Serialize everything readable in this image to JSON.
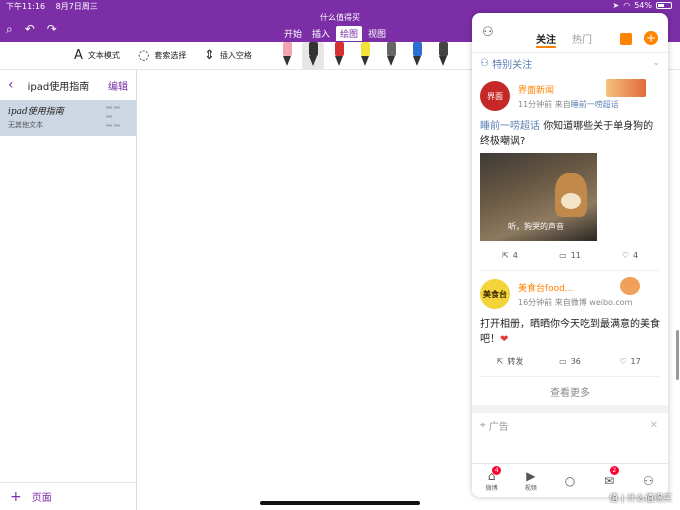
{
  "status": {
    "time": "下午11:16",
    "date": "8月7日周三",
    "battery": "54%",
    "battery_level": 0.54
  },
  "app": {
    "title": "什么值得买"
  },
  "ribbon": {
    "tabs": [
      "开始",
      "插入",
      "绘图",
      "视图"
    ],
    "active_tab": "绘图"
  },
  "toolbar": {
    "text_mode": "文本模式",
    "lasso": "套索选择",
    "insert_space": "插入空格",
    "pens": [
      {
        "name": "eraser",
        "color": "#f2a5b0"
      },
      {
        "name": "pen-black-selected",
        "color": "#333333"
      },
      {
        "name": "pen-red",
        "color": "#d63030"
      },
      {
        "name": "highlighter-yellow",
        "color": "#f4e23a"
      },
      {
        "name": "pen-gray",
        "color": "#666666"
      },
      {
        "name": "pen-blue",
        "color": "#2a6fd4"
      },
      {
        "name": "pen-dark",
        "color": "#444444"
      }
    ]
  },
  "sidebar": {
    "title": "ipad使用指南",
    "edit": "编辑",
    "page": {
      "title": "ipad使用指南",
      "subtitle": "无其他文本"
    },
    "add_page": "页面"
  },
  "weibo": {
    "tabs": [
      "关注",
      "热门"
    ],
    "special_follow": "特别关注",
    "posts": [
      {
        "avatar": "界面",
        "name": "界面新闻",
        "time": "11分钟前",
        "source_prefix": "来自",
        "source": "睡前一唠超话",
        "topic": "睡前一唠超话",
        "text": "你知道哪些关于单身狗的终极嘲讽?",
        "image_caption": "听，狗哭的声音",
        "actions": [
          "4",
          "11",
          "4"
        ]
      },
      {
        "avatar": "美食台",
        "name": "美食台food...",
        "time": "16分钟前",
        "source_prefix": "来自微博",
        "source": "weibo.com",
        "text": "打开相册，晒晒你今天吃到最满意的美食吧！",
        "actions": [
          "转发",
          "36",
          "17"
        ]
      }
    ],
    "more": "查看更多",
    "ad": "广告",
    "nav": [
      {
        "label": "微博",
        "badge": "4"
      },
      {
        "label": "视频",
        "badge": ""
      },
      {
        "label": "",
        "badge": ""
      },
      {
        "label": "",
        "badge": "2"
      },
      {
        "label": "",
        "badge": ""
      }
    ]
  },
  "watermark": "值 | 什么值得买"
}
